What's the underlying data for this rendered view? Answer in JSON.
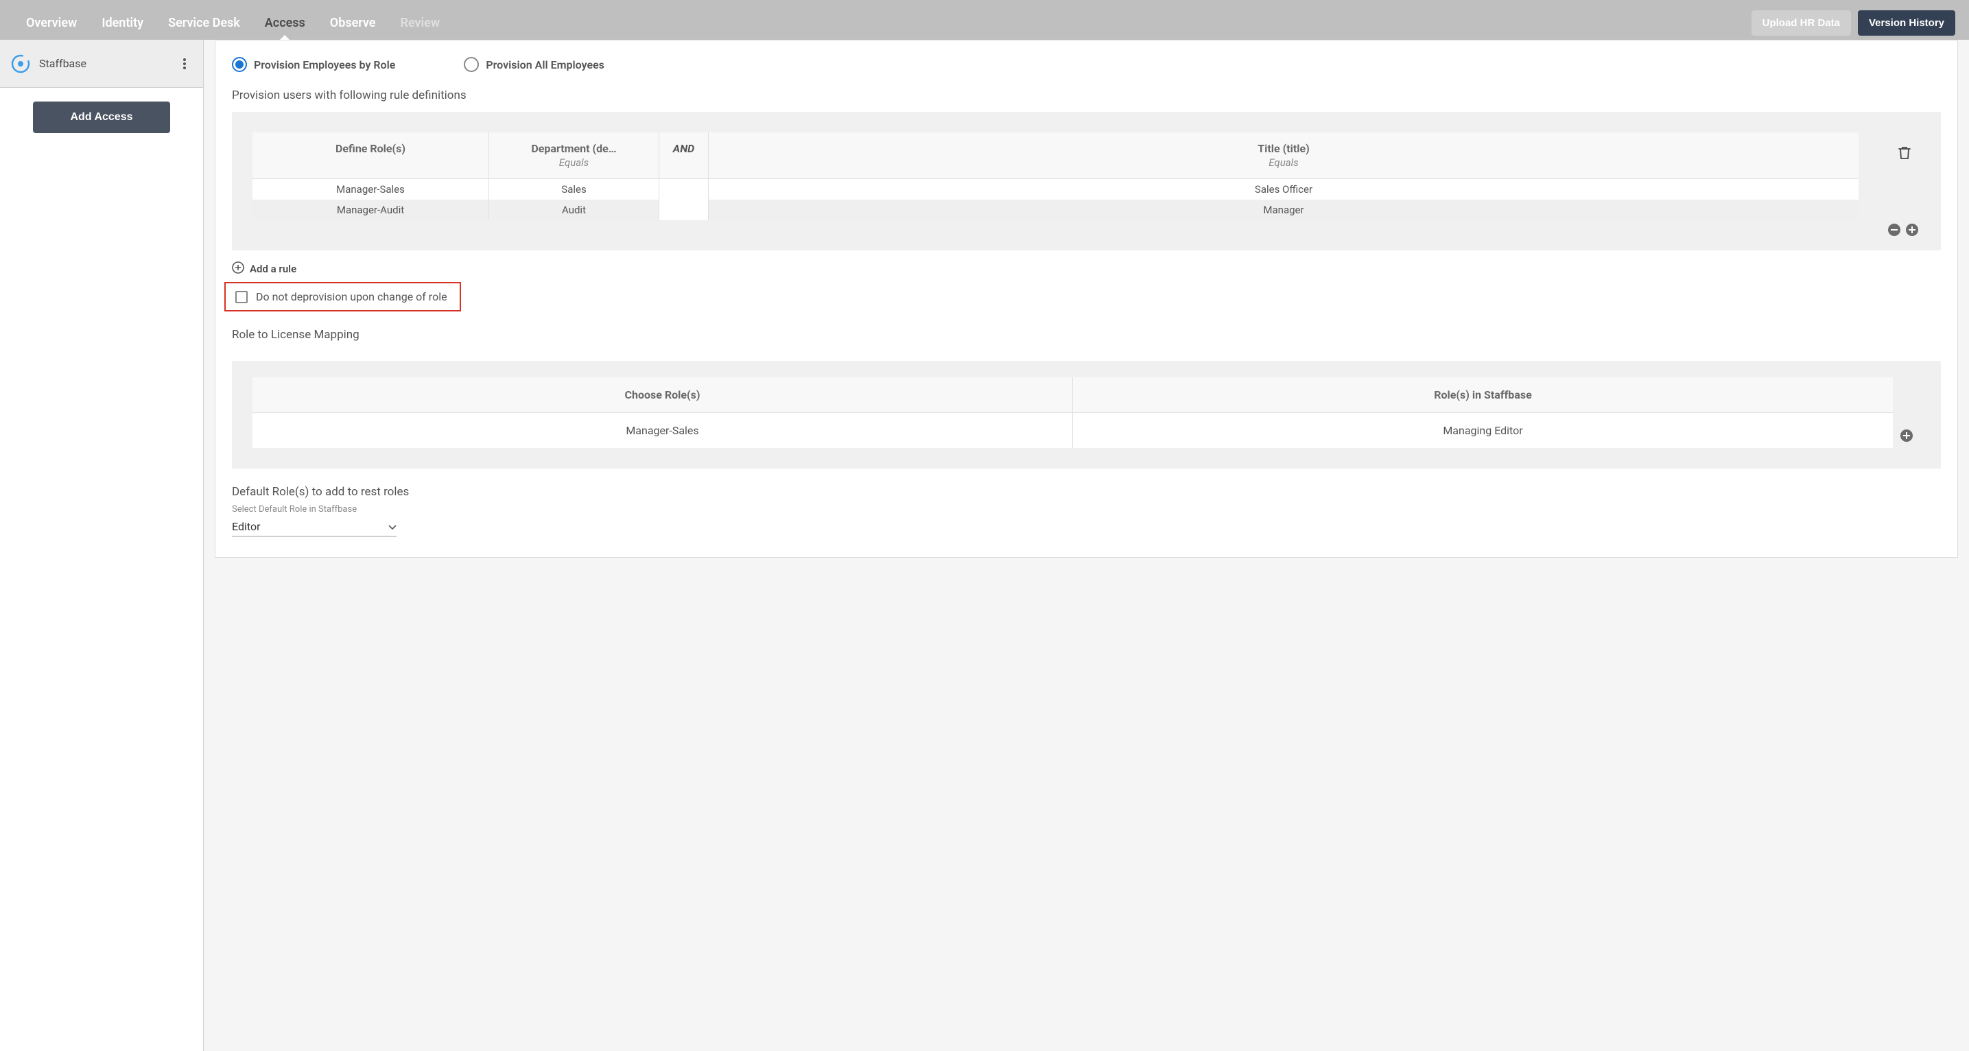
{
  "nav": {
    "tabs": {
      "overview": "Overview",
      "identity": "Identity",
      "servicedesk": "Service Desk",
      "access": "Access",
      "observe": "Observe",
      "review": "Review"
    },
    "upload": "Upload HR Data",
    "version": "Version History"
  },
  "sidebar": {
    "app": "Staffbase",
    "add_access": "Add Access"
  },
  "radios": {
    "by_role": "Provision Employees by Role",
    "all": "Provision All Employees"
  },
  "sections": {
    "rules_title": "Provision users with following rule definitions",
    "mapping_title": "Role to License Mapping",
    "default_title": "Default Role(s) to add to rest roles",
    "default_sub": "Select Default Role in Staffbase"
  },
  "rule_table": {
    "headers": {
      "define": "Define Role(s)",
      "dept": "Department (de…",
      "dept_sub": "Equals",
      "and": "AND",
      "title": "Title (title)",
      "title_sub": "Equals"
    },
    "rows": [
      {
        "role": "Manager-Sales",
        "dept": "Sales",
        "title": "Sales Officer"
      },
      {
        "role": "Manager-Audit",
        "dept": "Audit",
        "title": "Manager"
      }
    ]
  },
  "add_rule": "Add a rule",
  "deprov": "Do not deprovision upon change of role",
  "mapping_table": {
    "headers": {
      "choose": "Choose Role(s)",
      "roles_in": "Role(s) in Staffbase"
    },
    "rows": [
      {
        "choose": "Manager-Sales",
        "roles_in": "Managing Editor"
      }
    ]
  },
  "default_value": "Editor"
}
